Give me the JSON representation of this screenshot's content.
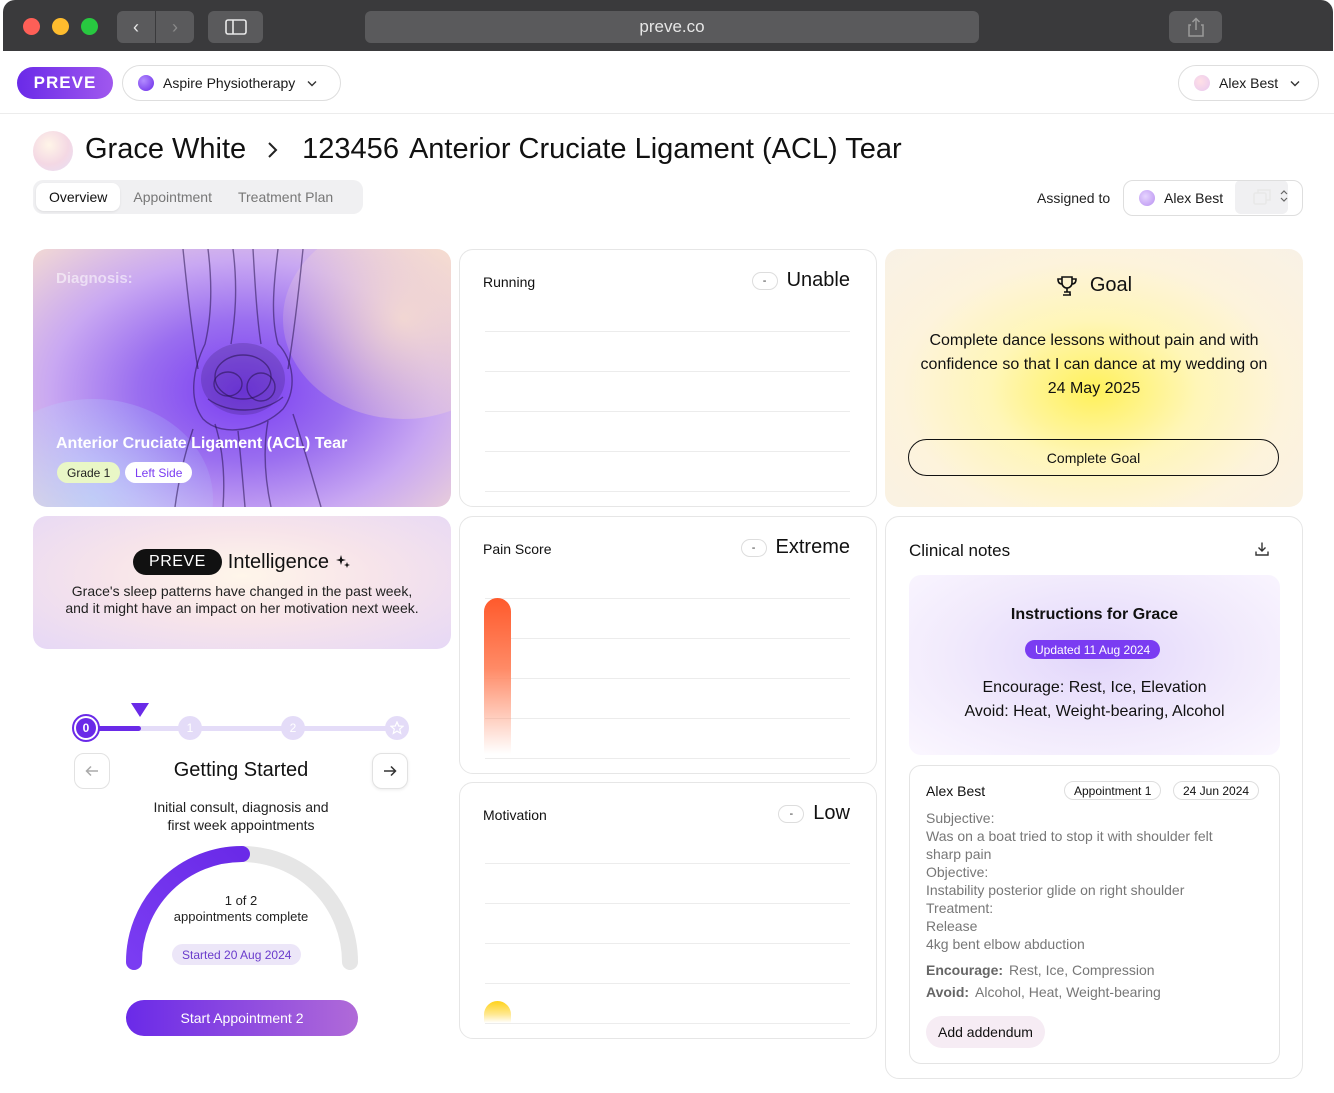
{
  "browser": {
    "url": "preve.co",
    "back_icon": "‹",
    "forward_icon": "›"
  },
  "header": {
    "logo": "PREVE",
    "clinic": "Aspire Physiotherapy",
    "user": "Alex Best"
  },
  "page": {
    "patient_name": "Grace White",
    "case_number": "123456",
    "case_title": "Anterior Cruciate Ligament (ACL) Tear",
    "tabs": [
      "Overview",
      "Appointment",
      "Treatment Plan"
    ],
    "active_tab": "Overview",
    "assigned_label": "Assigned to",
    "assigned_to": "Alex Best"
  },
  "diagnosis": {
    "label": "Diagnosis:",
    "name": "Anterior Cruciate Ligament (ACL) Tear",
    "grade": "Grade 1",
    "side": "Left Side"
  },
  "intelligence": {
    "tag": "PREVE",
    "title": "Intelligence",
    "line1": "Grace's sleep patterns have changed in the past week,",
    "line2": "and it might have an impact on her motivation next week."
  },
  "progress": {
    "steps": [
      "0",
      "1",
      "2"
    ],
    "current_step": 0,
    "stage_title": "Getting Started",
    "stage_desc_1": "Initial consult, diagnosis and",
    "stage_desc_2": "first week appointments",
    "completed": 1,
    "total": 2,
    "complete_line1": "1 of 2",
    "complete_line2": "appointments complete",
    "started": "Started 20 Aug 2024",
    "cta": "Start Appointment 2"
  },
  "metrics": {
    "running": {
      "label": "Running",
      "value": "Unable",
      "minus": "-"
    },
    "pain": {
      "label": "Pain Score",
      "value": "Extreme",
      "minus": "-",
      "level": 1.0,
      "color": "#ff5a2c"
    },
    "motivation": {
      "label": "Motivation",
      "value": "Low",
      "minus": "-",
      "level": 0.1,
      "color": "#ffd21a"
    }
  },
  "goal": {
    "title": "Goal",
    "text_1": "Complete dance lessons without pain and with",
    "text_2": "confidence so that I can dance at my wedding on",
    "text_3": "24 May 2025",
    "button": "Complete Goal"
  },
  "notes": {
    "title": "Clinical notes",
    "instructions": {
      "title": "Instructions for Grace",
      "updated": "Updated 11 Aug 2024",
      "encourage": "Encourage: Rest, Ice, Elevation",
      "avoid": "Avoid: Heat, Weight-bearing, Alcohol"
    },
    "entry": {
      "author": "Alex Best",
      "appointment": "Appointment 1",
      "date": "24 Jun 2024",
      "lines": [
        "Subjective:",
        "Was on a boat tried to stop it with shoulder felt",
        "sharp pain",
        "Objective:",
        "Instability posterior glide on right shoulder",
        "Treatment:",
        "Release",
        "4kg bent elbow abduction"
      ],
      "encourage_label": "Encourage:",
      "encourage": "Rest, Ice, Compression",
      "avoid_label": "Avoid:",
      "avoid": "Alcohol, Heat, Weight-bearing",
      "addendum": "Add addendum"
    }
  },
  "colors": {
    "accent": "#6a2ae8",
    "pain": "#ff5a2c",
    "motivation": "#ffd21a"
  }
}
